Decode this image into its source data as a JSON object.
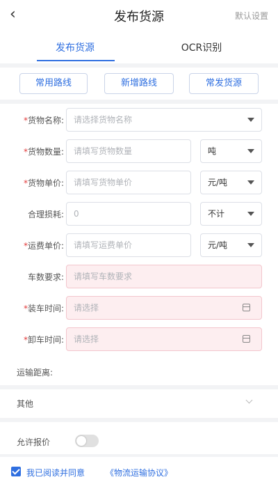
{
  "header": {
    "back_icon": "‹",
    "title": "发布货源",
    "right_action": "默认设置"
  },
  "tabs": [
    {
      "label": "发布货源",
      "active": true
    },
    {
      "label": "OCR识别",
      "active": false
    }
  ],
  "route_buttons": [
    "常用路线",
    "新增路线",
    "常发货源"
  ],
  "form": {
    "cargo_name": {
      "label": "货物名称:",
      "required": true,
      "placeholder": "请选择货物名称"
    },
    "cargo_qty": {
      "label": "货物数量:",
      "required": true,
      "placeholder": "请填写货物数量",
      "unit": "吨"
    },
    "cargo_price": {
      "label": "货物单价:",
      "required": true,
      "placeholder": "请填写货物单价",
      "unit": "元/吨"
    },
    "loss": {
      "label": "合理损耗:",
      "required": false,
      "value": "0",
      "unit": "不计"
    },
    "freight_price": {
      "label": "运费单价:",
      "required": true,
      "placeholder": "请填写运费单价",
      "unit": "元/吨"
    },
    "vehicle_req": {
      "label": "车数要求:",
      "required": false,
      "placeholder": "请填写车数要求"
    },
    "load_time": {
      "label": "装车时间:",
      "required": true,
      "placeholder": "请选择"
    },
    "unload_time": {
      "label": "卸车时间:",
      "required": true,
      "placeholder": "请选择"
    }
  },
  "distance_label": "运输距离:",
  "other_label": "其他",
  "allow_quote_label": "允许报价",
  "agreement": {
    "text": "我已阅读并同意",
    "link": "《物流运输协议》",
    "checked": true
  },
  "required_marker": "*",
  "colors": {
    "accent": "#2f6fe0",
    "required": "#e23b3b",
    "pink_field": "#fdeef0"
  }
}
